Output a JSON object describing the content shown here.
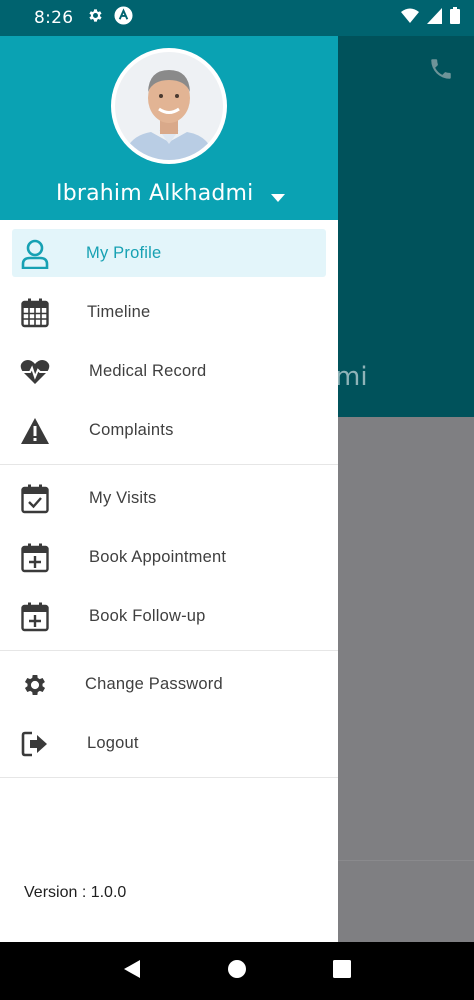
{
  "status_bar": {
    "time": "8:26",
    "icons": [
      "gear-icon",
      "app-a-icon",
      "wifi-icon",
      "signal-icon",
      "battery-icon"
    ]
  },
  "background": {
    "name_fragment": "mi",
    "icon": "phone-icon"
  },
  "drawer": {
    "user_name": "Ibrahim Alkhadmi",
    "accent_color": "#0aa2b3",
    "active_bg_color": "#e3f5fa",
    "groups": [
      [
        {
          "label": "My Profile",
          "icon": "person-icon",
          "active": true
        },
        {
          "label": "Timeline",
          "icon": "calendar-grid-icon",
          "active": false
        },
        {
          "label": "Medical Record",
          "icon": "heartbeat-icon",
          "active": false
        },
        {
          "label": "Complaints",
          "icon": "warning-icon",
          "active": false
        }
      ],
      [
        {
          "label": "My Visits",
          "icon": "calendar-check-icon",
          "active": false
        },
        {
          "label": "Book Appointment",
          "icon": "calendar-plus-icon",
          "active": false
        },
        {
          "label": "Book Follow-up",
          "icon": "calendar-plus-icon",
          "active": false
        }
      ],
      [
        {
          "label": "Change Password",
          "icon": "gear-icon",
          "active": false
        },
        {
          "label": "Logout",
          "icon": "logout-icon",
          "active": false
        }
      ]
    ],
    "version": "Version : 1.0.0"
  },
  "nav_bar": {
    "buttons": [
      "back-icon",
      "home-icon",
      "recents-icon"
    ]
  }
}
